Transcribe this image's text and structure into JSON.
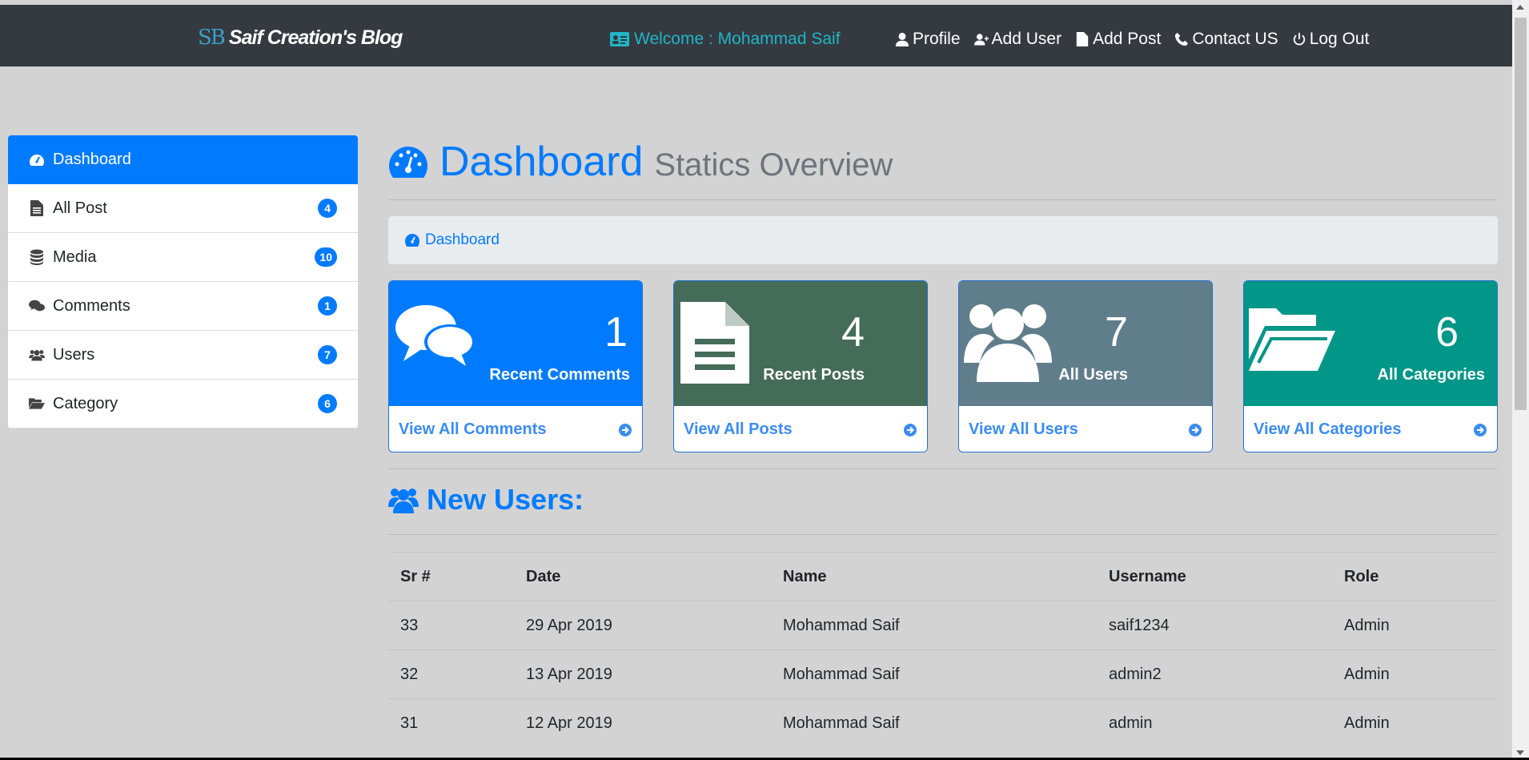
{
  "header": {
    "brand_logo": "SB",
    "brand_name": "Saif Creation's Blog",
    "welcome": "Welcome : Mohammad Saif",
    "nav": [
      {
        "label": "Profile",
        "icon": "user-icon"
      },
      {
        "label": "Add User",
        "icon": "user-plus-icon"
      },
      {
        "label": "Add Post",
        "icon": "file-icon"
      },
      {
        "label": "Contact US",
        "icon": "phone-icon"
      },
      {
        "label": "Log Out",
        "icon": "power-icon"
      }
    ]
  },
  "sidebar": {
    "items": [
      {
        "label": "Dashboard",
        "icon": "tachometer-icon",
        "badge": null
      },
      {
        "label": "All Post",
        "icon": "file-text-icon",
        "badge": "4"
      },
      {
        "label": "Media",
        "icon": "database-icon",
        "badge": "10"
      },
      {
        "label": "Comments",
        "icon": "comments-icon",
        "badge": "1"
      },
      {
        "label": "Users",
        "icon": "users-icon",
        "badge": "7"
      },
      {
        "label": "Category",
        "icon": "folder-open-icon",
        "badge": "6"
      }
    ]
  },
  "main": {
    "title": "Dashboard",
    "subtitle": "Statics Overview",
    "breadcrumb": "Dashboard",
    "cards": [
      {
        "count": "1",
        "label": "Recent Comments",
        "link": "View All Comments",
        "color": "#007bff",
        "icon": "comments-icon"
      },
      {
        "count": "4",
        "label": "Recent Posts",
        "link": "View All Posts",
        "color": "#456b59",
        "icon": "file-text-icon"
      },
      {
        "count": "7",
        "label": "All Users",
        "link": "View All Users",
        "color": "#607d8b",
        "icon": "users-icon"
      },
      {
        "count": "6",
        "label": "All Categories",
        "link": "View All Categories",
        "color": "#009688",
        "icon": "folder-open-icon"
      }
    ],
    "section_title": "New Users:",
    "table": {
      "headers": [
        "Sr #",
        "Date",
        "Name",
        "Username",
        "Role"
      ],
      "rows": [
        [
          "33",
          "29 Apr 2019",
          "Mohammad Saif",
          "saif1234",
          "Admin"
        ],
        [
          "32",
          "13 Apr 2019",
          "Mohammad Saif",
          "admin2",
          "Admin"
        ],
        [
          "31",
          "12 Apr 2019",
          "Mohammad Saif",
          "admin",
          "Admin"
        ]
      ]
    }
  },
  "colors": {
    "accent": "#007bff",
    "navbar": "#343a40",
    "background": "#d3d3d3"
  }
}
